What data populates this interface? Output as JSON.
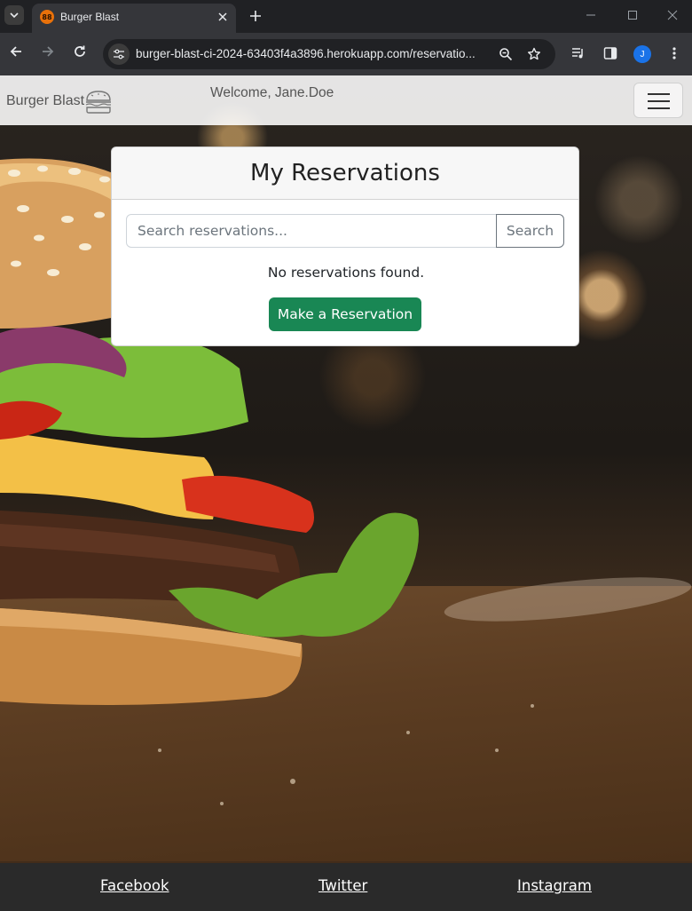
{
  "browser": {
    "tab_title": "Burger Blast",
    "favicon_text": "88",
    "url": "burger-blast-ci-2024-63403f4a3896.herokuapp.com/reservatio...",
    "profile_initial": "J",
    "accent_color": "#1a73e8"
  },
  "icons": {
    "tab_dropdown": "chevron-down-icon",
    "tab_close": "close-icon",
    "new_tab": "plus-icon",
    "minimize": "minimize-icon",
    "maximize": "maximize-icon",
    "window_close": "close-icon",
    "back": "arrow-left-icon",
    "forward": "arrow-right-icon",
    "reload": "reload-icon",
    "site_info": "tune-icon",
    "zoom": "zoom-icon",
    "bookmark": "star-icon",
    "media": "media-queue-icon",
    "side_panel": "side-panel-icon",
    "menu": "kebab-menu-icon",
    "hamburger": "hamburger-menu-icon",
    "brand": "burger-logo-icon"
  },
  "navbar": {
    "brand": "Burger Blast",
    "welcome": "Welcome, Jane.Doe"
  },
  "reservations": {
    "title": "My Reservations",
    "search_placeholder": "Search reservations...",
    "search_value": "",
    "search_button": "Search",
    "empty_message": "No reservations found.",
    "make_button": "Make a Reservation",
    "button_color": "#198754"
  },
  "footer": {
    "links": [
      "Facebook",
      "Twitter",
      "Instagram"
    ]
  }
}
